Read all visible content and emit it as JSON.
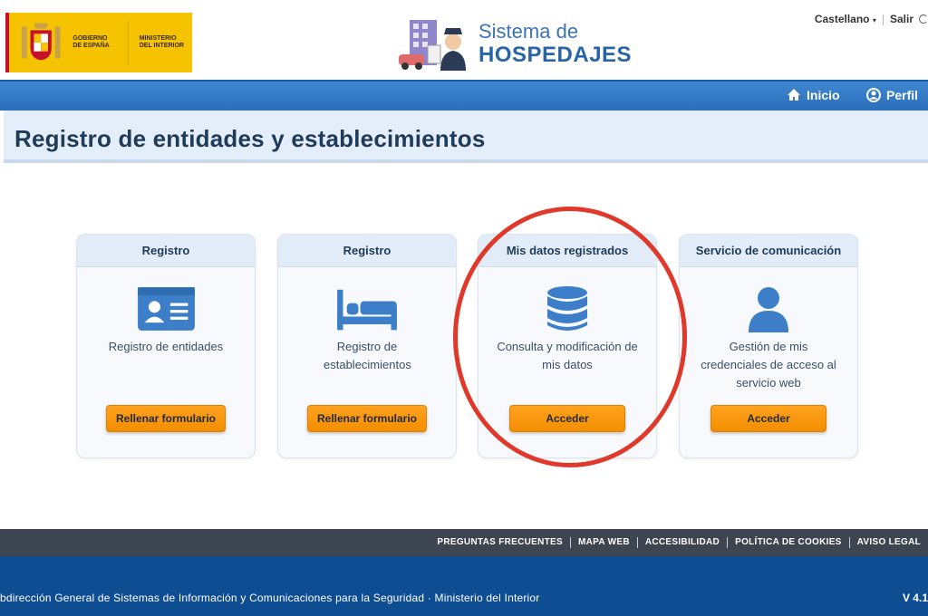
{
  "header": {
    "gov_line1": "GOBIERNO",
    "gov_line2": "DE ESPAÑA",
    "min_line1": "MINISTERIO",
    "min_line2": "DEL INTERIOR",
    "app_line1": "Sistema de",
    "app_line2": "HOSPEDAJES",
    "language": "Castellano",
    "logout": "Salir",
    "separator": "|"
  },
  "nav": {
    "home": "Inicio",
    "profile": "Perfil"
  },
  "page": {
    "title": "Registro de entidades y establecimientos"
  },
  "cards": [
    {
      "heading": "Registro",
      "description": "Registro de entidades",
      "button": "Rellenar formulario",
      "icon": "id-card-icon"
    },
    {
      "heading": "Registro",
      "description": "Registro de establecimientos",
      "button": "Rellenar formulario",
      "icon": "bed-icon"
    },
    {
      "heading": "Mis datos registrados",
      "description": "Consulta y modificación de mis datos",
      "button": "Acceder",
      "icon": "database-icon"
    },
    {
      "heading": "Servicio de comunicación",
      "description": "Gestión de mis credenciales de acceso al servicio web",
      "button": "Acceder",
      "icon": "user-icon"
    }
  ],
  "footer": {
    "links": [
      "PREGUNTAS FRECUENTES",
      "MAPA WEB",
      "ACCESIBILIDAD",
      "POLÍTICA DE COOKIES",
      "AVISO LEGAL"
    ],
    "credit": "bdirección General de Sistemas de Información y Comunicaciones para la Seguridad   ·   Ministerio del Interior",
    "version": "V 4.1"
  },
  "colors": {
    "nav_blue": "#2b6fb9",
    "accent_orange": "#f38e00",
    "highlight_red": "#e0392b",
    "footer_blue": "#0f4d93",
    "footer_dark": "#3c4550"
  }
}
